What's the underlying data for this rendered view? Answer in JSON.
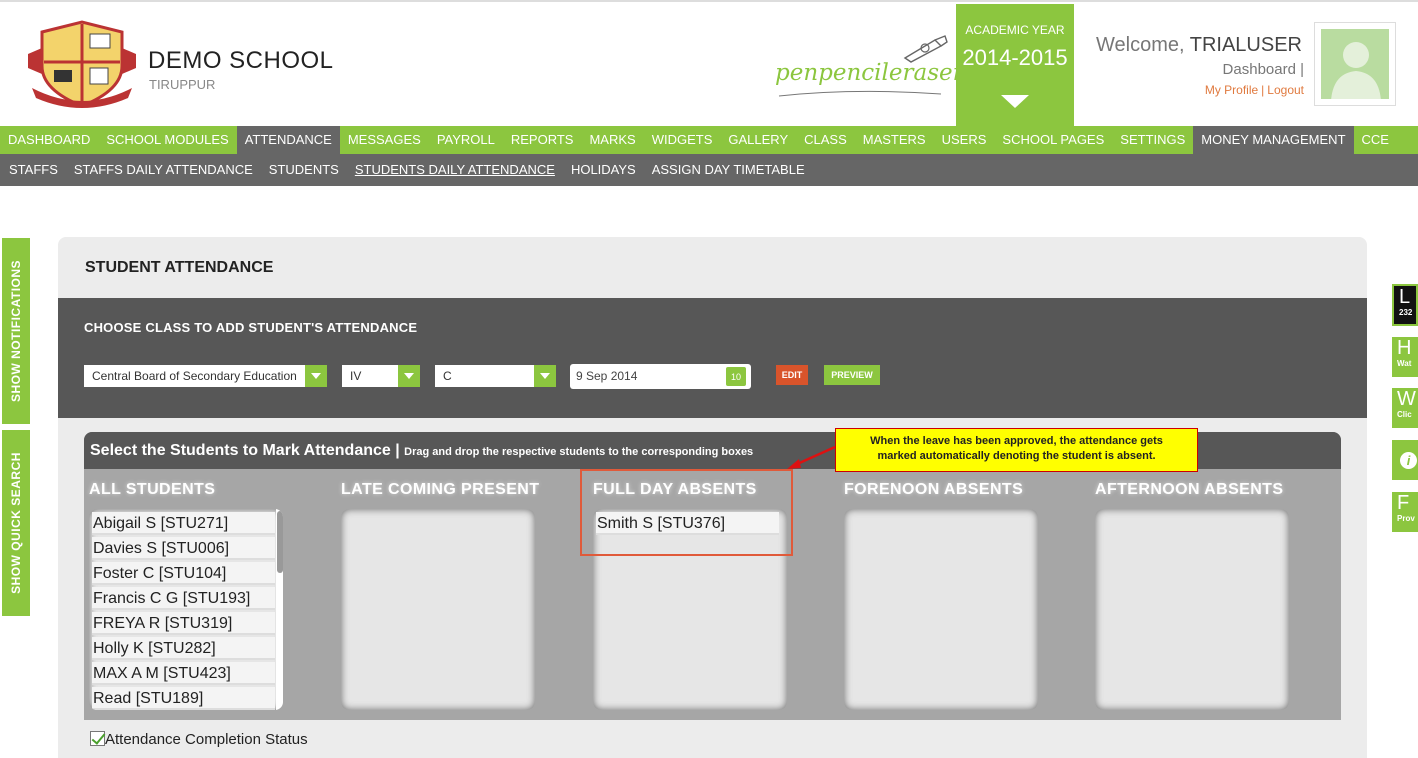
{
  "school": {
    "name": "DEMO SCHOOL",
    "city": "TIRUPPUR",
    "brand": "penpencileraser"
  },
  "academic_year": {
    "label": "ACADEMIC YEAR",
    "value": "2014-2015"
  },
  "user": {
    "welcome": "Welcome,",
    "name": "TRIALUSER",
    "dashboard": "Dashboard |",
    "profile": "My Profile",
    "sep": "|",
    "logout": "Logout"
  },
  "main_nav": [
    "DASHBOARD",
    "SCHOOL MODULES",
    "ATTENDANCE",
    "MESSAGES",
    "PAYROLL",
    "REPORTS",
    "MARKS",
    "WIDGETS",
    "GALLERY",
    "CLASS",
    "MASTERS",
    "USERS",
    "SCHOOL PAGES",
    "SETTINGS",
    "MONEY MANAGEMENT",
    "CCE"
  ],
  "sub_nav": [
    "STAFFS",
    "STAFFS DAILY ATTENDANCE",
    "STUDENTS",
    "STUDENTS DAILY ATTENDANCE",
    "HOLIDAYS",
    "ASSIGN DAY TIMETABLE"
  ],
  "side_tabs": {
    "notifications": "SHOW NOTIFICATIONS",
    "quick_search": "SHOW QUICK SEARCH"
  },
  "right_widgets": {
    "l": "L",
    "l_count": "232",
    "h": "H",
    "h_sub": "Wat",
    "w": "W",
    "w_sub": "Clic",
    "i": "i",
    "f": "F",
    "f_sub": "Prov"
  },
  "panel": {
    "title": "STUDENT ATTENDANCE",
    "filter_heading": "CHOOSE CLASS TO ADD STUDENT'S ATTENDANCE",
    "board": "Central Board of Secondary Education",
    "class": "IV",
    "section": "C",
    "date": "9 Sep 2014",
    "calendar_day": "10",
    "edit": "EDIT",
    "preview": "PREVIEW"
  },
  "students_area": {
    "title": "Select the Students to Mark Attendance |",
    "hint": "Drag and drop the respective students to the corresponding boxes",
    "columns": [
      "ALL STUDENTS",
      "LATE COMING PRESENT",
      "FULL DAY ABSENTS",
      "FORENOON ABSENTS",
      "AFTERNOON ABSENTS"
    ],
    "all_students": [
      "Abigail S [STU271]",
      "Davies S [STU006]",
      "Foster C [STU104]",
      "Francis C G [STU193]",
      "FREYA R [STU319]",
      "Holly K [STU282]",
      "MAX A M [STU423]",
      "Read [STU189]"
    ],
    "full_day_absents": [
      "Smith S [STU376]"
    ]
  },
  "callout": {
    "line1": "When the leave has been approved, the attendance gets",
    "line2": "marked automatically denoting the student is absent."
  },
  "completion_label": "Attendance Completion Status",
  "colors": {
    "accent": "#8cc63f",
    "dark": "#575757",
    "nav_active": "#666666",
    "edit": "#d9542b",
    "callout": "#ffff00"
  }
}
